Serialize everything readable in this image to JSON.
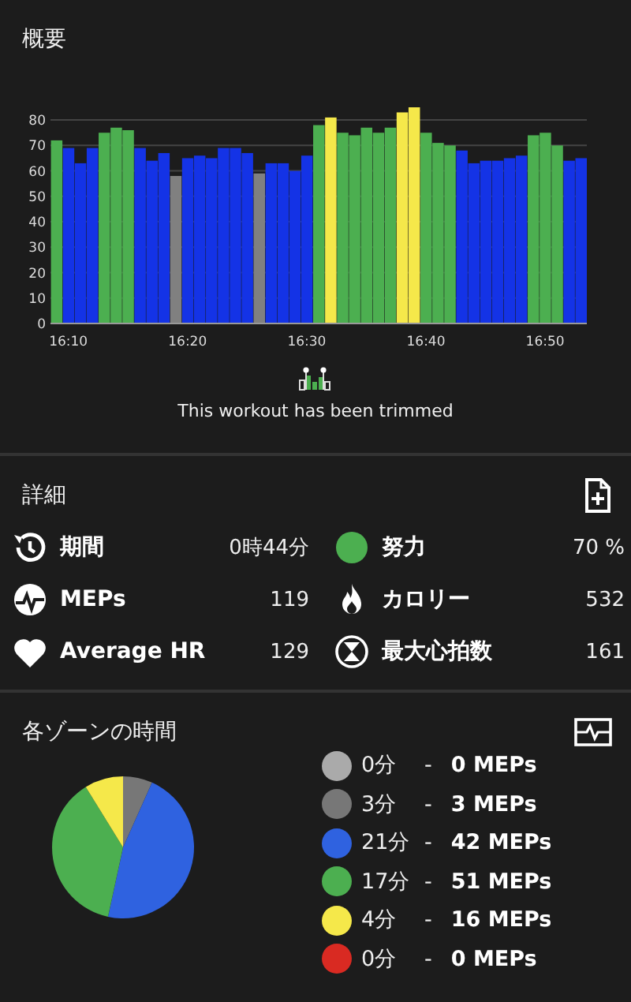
{
  "overview": {
    "title": "概要",
    "chart_data": {
      "type": "bar",
      "stacked": true,
      "categories": [
        null,
        "16:10",
        null,
        null,
        null,
        null,
        null,
        null,
        null,
        null,
        null,
        "16:20",
        null,
        null,
        null,
        null,
        null,
        null,
        null,
        null,
        null,
        "16:30",
        null,
        null,
        null,
        null,
        null,
        null,
        null,
        null,
        null,
        "16:40",
        null,
        null,
        null,
        null,
        null,
        null,
        null,
        null,
        null,
        "16:50",
        null,
        null,
        null
      ],
      "ylim": [
        0,
        85
      ],
      "grid": true,
      "yticks": [
        0,
        10,
        20,
        30,
        40,
        50,
        60,
        70,
        80
      ],
      "series": [
        {
          "color": "#808080",
          "values": [
            null,
            null,
            null,
            null,
            null,
            null,
            null,
            null,
            null,
            null,
            58,
            null,
            null,
            null,
            null,
            null,
            null,
            59,
            null,
            null,
            null,
            null,
            null,
            null,
            null,
            null,
            null,
            null,
            null,
            null,
            null,
            null,
            null,
            null,
            null,
            null,
            null,
            null,
            null,
            null,
            null,
            null,
            null,
            null,
            null
          ]
        },
        {
          "color": "#1433e6",
          "values": [
            null,
            69,
            63,
            69,
            null,
            null,
            null,
            69,
            64,
            67,
            null,
            65,
            66,
            65,
            69,
            69,
            67,
            null,
            63,
            63,
            60,
            66,
            null,
            null,
            null,
            null,
            null,
            null,
            null,
            null,
            null,
            null,
            null,
            null,
            68,
            63,
            64,
            64,
            65,
            66,
            null,
            null,
            null,
            64,
            65
          ]
        },
        {
          "color": "#4caf50",
          "values": [
            72,
            null,
            null,
            null,
            75,
            77,
            76,
            null,
            null,
            null,
            null,
            null,
            null,
            null,
            null,
            null,
            null,
            null,
            null,
            null,
            null,
            null,
            78,
            null,
            75,
            74,
            77,
            75,
            77,
            null,
            null,
            75,
            71,
            70,
            null,
            null,
            null,
            null,
            null,
            null,
            74,
            75,
            70,
            null,
            null
          ]
        },
        {
          "color": "#f5e84a",
          "values": [
            null,
            null,
            null,
            null,
            null,
            null,
            null,
            null,
            null,
            null,
            null,
            null,
            null,
            null,
            null,
            null,
            null,
            null,
            null,
            null,
            null,
            null,
            null,
            81,
            null,
            null,
            null,
            null,
            null,
            83,
            85,
            null,
            null,
            null,
            null,
            null,
            null,
            null,
            null,
            null,
            null,
            null,
            null,
            null,
            null
          ]
        }
      ]
    },
    "trim_note": "This workout has been trimmed"
  },
  "details": {
    "title": "詳細",
    "stats": [
      {
        "label": "期間",
        "value": "0時44分"
      },
      {
        "label": "努力",
        "value": "70 %"
      },
      {
        "label": "MEPs",
        "value": "119"
      },
      {
        "label": "カロリー",
        "value": "532"
      },
      {
        "label": "Average HR",
        "value": "129"
      },
      {
        "label": "最大心拍数",
        "value": "161"
      }
    ]
  },
  "zones": {
    "title": "各ゾーンの時間",
    "chart_data": {
      "type": "pie",
      "values": [
        0,
        6.7,
        46.7,
        37.8,
        8.8,
        0
      ]
    },
    "legend": [
      {
        "color": "#aaaaaa",
        "minutes": "0分",
        "dash": "-",
        "meps": "0 MEPs"
      },
      {
        "color": "#777777",
        "minutes": "3分",
        "dash": "-",
        "meps": "3 MEPs"
      },
      {
        "color": "#2f62e0",
        "minutes": "21分",
        "dash": "-",
        "meps": "42 MEPs"
      },
      {
        "color": "#4caf50",
        "minutes": "17分",
        "dash": "-",
        "meps": "51 MEPs"
      },
      {
        "color": "#f5e84a",
        "minutes": "4分",
        "dash": "-",
        "meps": "16 MEPs"
      },
      {
        "color": "#d92a22",
        "minutes": "0分",
        "dash": "-",
        "meps": "0 MEPs"
      }
    ]
  }
}
